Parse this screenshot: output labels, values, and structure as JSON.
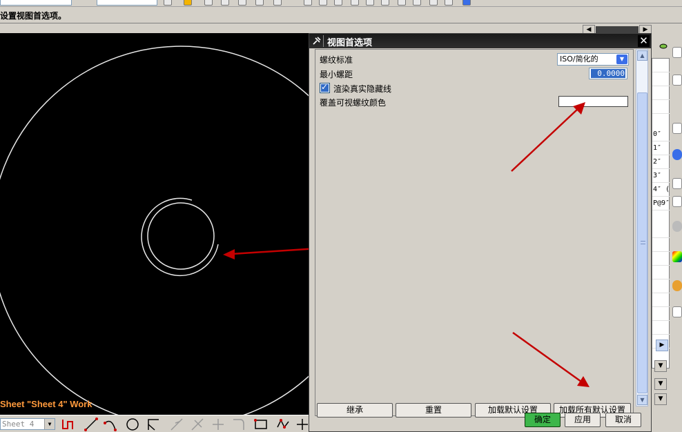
{
  "cue_line": {
    "prompt": "设置视图首选项。"
  },
  "viewport": {
    "sheet_label": "Sheet \"Sheet 4\" Work"
  },
  "bottom_toolbar": {
    "sheet_combo_value": "Sheet 4"
  },
  "dialog": {
    "title": "视图首选项",
    "close_glyph": "✕",
    "thread_standard_label": "螺纹标准",
    "thread_standard_value": "ISO/简化的",
    "min_pitch_label": "最小螺距",
    "min_pitch_value": "0.0000",
    "render_hidden_label": "渲染真实隐藏线",
    "render_hidden_checked": true,
    "override_color_label": "覆盖可视螺纹颜色",
    "override_color_value": "#ffffff",
    "buttons": {
      "inherit": "继承",
      "reset": "重置",
      "load_defaults": "加载默认设置",
      "load_all_defaults": "加载所有默认设置",
      "ok": "确定",
      "apply": "应用",
      "cancel": "取消"
    }
  },
  "right_panel": {
    "rows": [
      "0″",
      "1″",
      "2″",
      "3″",
      "4″ (",
      "P@9″"
    ]
  },
  "colors": {
    "viewport_bg": "#000000",
    "sheet_label": "#ff9a3c",
    "annotation_arrow": "#c40000",
    "ok_button": "#3cb64a"
  }
}
